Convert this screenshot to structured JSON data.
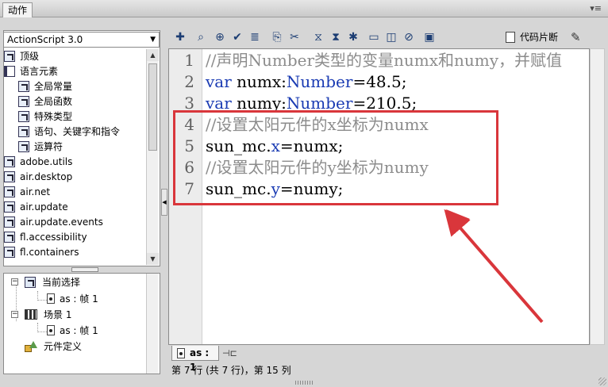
{
  "window": {
    "tab_title": "动作",
    "menu_glyph": "▾≡"
  },
  "left_panel": {
    "version_select": "ActionScript 3.0",
    "library_items": [
      {
        "label": "顶级",
        "icon": "package-icon",
        "sub": false
      },
      {
        "label": "语言元素",
        "icon": "book-icon",
        "sub": false
      },
      {
        "label": "全局常量",
        "icon": "package-icon",
        "sub": true
      },
      {
        "label": "全局函数",
        "icon": "package-icon",
        "sub": true
      },
      {
        "label": "特殊类型",
        "icon": "package-icon",
        "sub": true
      },
      {
        "label": "语句、关键字和指令",
        "icon": "package-icon",
        "sub": true
      },
      {
        "label": "运算符",
        "icon": "package-icon",
        "sub": true
      },
      {
        "label": "adobe.utils",
        "icon": "package-icon",
        "sub": false
      },
      {
        "label": "air.desktop",
        "icon": "package-icon",
        "sub": false
      },
      {
        "label": "air.net",
        "icon": "package-icon",
        "sub": false
      },
      {
        "label": "air.update",
        "icon": "package-icon",
        "sub": false
      },
      {
        "label": "air.update.events",
        "icon": "package-icon",
        "sub": false
      },
      {
        "label": "fl.accessibility",
        "icon": "package-icon",
        "sub": false
      },
      {
        "label": "fl.containers",
        "icon": "package-icon",
        "sub": false
      }
    ],
    "tree": {
      "current_selection": "当前选择",
      "current_frame": "as : 帧 1",
      "scene": "场景 1",
      "scene_frame": "as : 帧 1",
      "symbol_definitions": "元件定义"
    }
  },
  "toolbar": {
    "icons": [
      "add-statement-icon",
      "find-icon",
      "target-path-icon",
      "check-syntax-icon",
      "auto-format-icon",
      "code-hint-icon",
      "debug-options-icon",
      "collapse-between-braces-icon",
      "collapse-selection-icon",
      "expand-all-icon",
      "apply-block-comment-icon",
      "apply-line-comment-icon",
      "remove-comment-icon",
      "show-hide-toolbox-icon"
    ],
    "snippets_label": "代码片断",
    "wand_icon": "script-assist-icon"
  },
  "editor": {
    "lines": [
      {
        "n": "1",
        "parts": [
          {
            "t": "//声明Number类型的变量numx和numy，并赋值",
            "c": "cm"
          }
        ]
      },
      {
        "n": "2",
        "parts": [
          {
            "t": "var ",
            "c": "kw"
          },
          {
            "t": "numx:",
            "c": "tx"
          },
          {
            "t": "Number",
            "c": "ty"
          },
          {
            "t": "=48.5;",
            "c": "tx"
          }
        ]
      },
      {
        "n": "3",
        "parts": [
          {
            "t": "var ",
            "c": "kw"
          },
          {
            "t": "numy:",
            "c": "tx"
          },
          {
            "t": "Number",
            "c": "ty"
          },
          {
            "t": "=210.5;",
            "c": "tx"
          }
        ]
      },
      {
        "n": "4",
        "parts": [
          {
            "t": "//设置太阳元件的x坐标为numx",
            "c": "cm"
          }
        ]
      },
      {
        "n": "5",
        "parts": [
          {
            "t": "sun_mc.",
            "c": "tx"
          },
          {
            "t": "x",
            "c": "kw"
          },
          {
            "t": "=numx;",
            "c": "tx"
          }
        ]
      },
      {
        "n": "6",
        "parts": [
          {
            "t": "//设置太阳元件的y坐标为numy",
            "c": "cm"
          }
        ]
      },
      {
        "n": "7",
        "parts": [
          {
            "t": "sun_mc.",
            "c": "tx"
          },
          {
            "t": "y",
            "c": "kw"
          },
          {
            "t": "=numy;",
            "c": "tx"
          }
        ]
      }
    ],
    "highlight_color": "#d9363b"
  },
  "bottom": {
    "tab_label": "as : 1",
    "status": "第 7 行 (共 7 行)，第 15 列"
  }
}
